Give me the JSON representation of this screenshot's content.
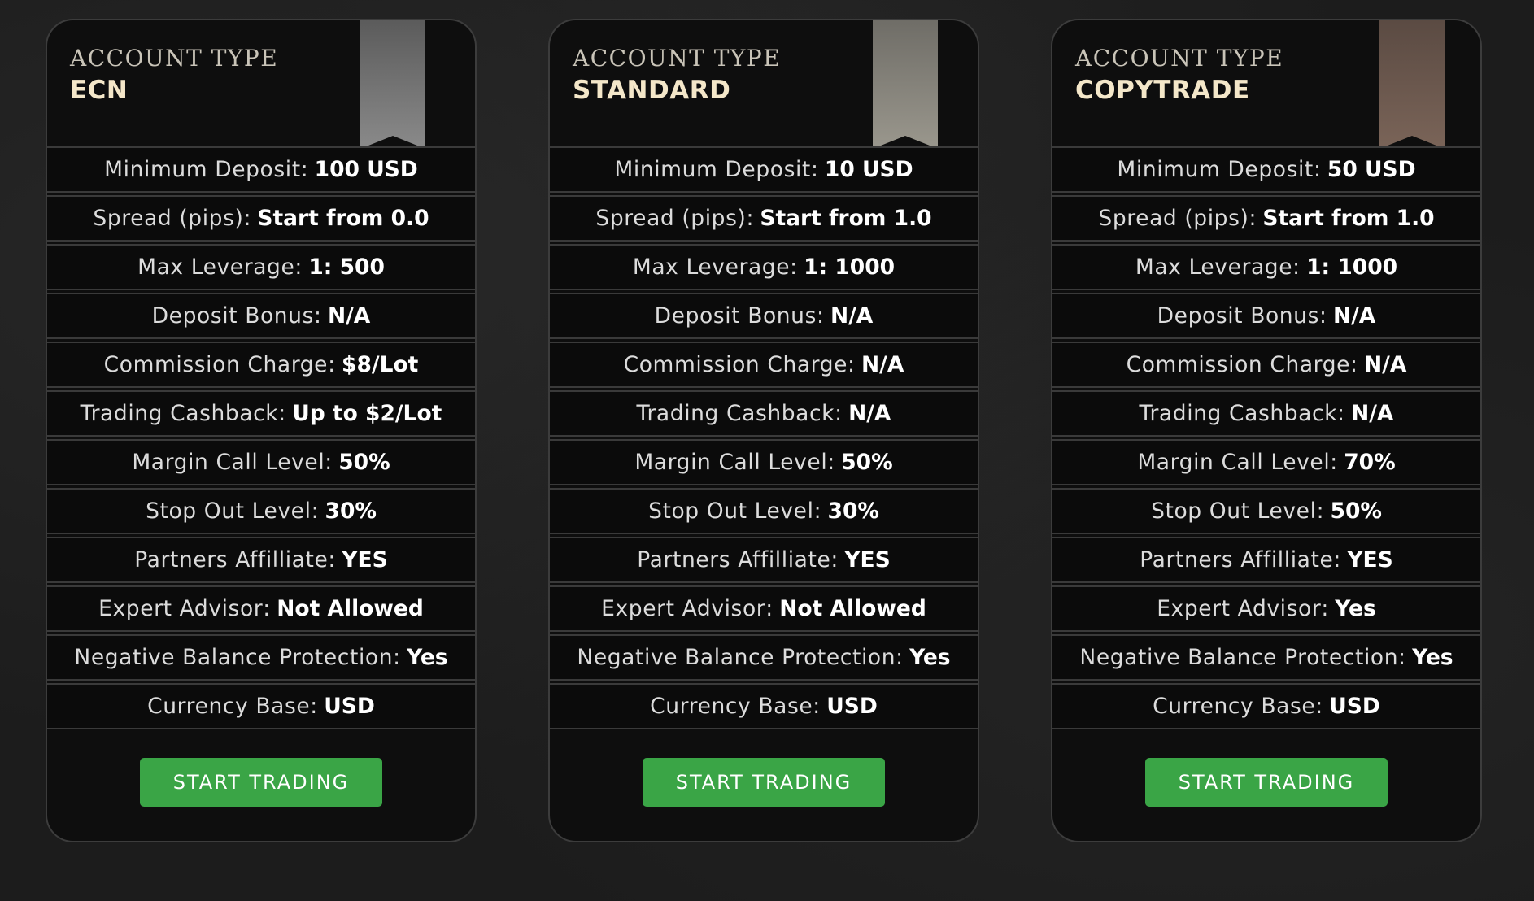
{
  "header_label": "ACCOUNT TYPE",
  "colors": {
    "background": "#1c1c1c",
    "card_background": "#0e0e0e",
    "account_name": "#f4e7c9",
    "button": "#3aa546",
    "ribbon_ecn": "#7a7a7a",
    "ribbon_standard": "#8c8a82",
    "ribbon_copytrade": "#6a5a50"
  },
  "cards": [
    {
      "header_label": "ACCOUNT TYPE",
      "name": "ECN",
      "ribbon_icon": "bookmark-ribbon-icon",
      "features": [
        {
          "label": "Minimum Deposit",
          "value": "100 USD"
        },
        {
          "label": "Spread (pips)",
          "value": "Start from 0.0"
        },
        {
          "label": "Max Leverage",
          "value": "1: 500"
        },
        {
          "label": "Deposit Bonus",
          "value": "N/A"
        },
        {
          "label": "Commission Charge",
          "value": "$8/Lot"
        },
        {
          "label": "Trading Cashback",
          "value": "Up to $2/Lot"
        },
        {
          "label": "Margin Call Level",
          "value": "50%"
        },
        {
          "label": "Stop Out Level",
          "value": "30%"
        },
        {
          "label": "Partners Affilliate",
          "value": "YES"
        },
        {
          "label": "Expert Advisor",
          "value": "Not Allowed"
        },
        {
          "label": "Negative Balance Protection",
          "value": "Yes"
        },
        {
          "label": "Currency Base",
          "value": "USD"
        }
      ],
      "button_label": "START TRADING"
    },
    {
      "header_label": "ACCOUNT TYPE",
      "name": "STANDARD",
      "ribbon_icon": "bookmark-ribbon-icon",
      "features": [
        {
          "label": "Minimum Deposit",
          "value": "10 USD"
        },
        {
          "label": "Spread (pips)",
          "value": "Start from 1.0"
        },
        {
          "label": "Max Leverage",
          "value": "1: 1000"
        },
        {
          "label": "Deposit Bonus",
          "value": "N/A"
        },
        {
          "label": "Commission Charge",
          "value": "N/A"
        },
        {
          "label": "Trading Cashback",
          "value": "N/A"
        },
        {
          "label": "Margin Call Level",
          "value": "50%"
        },
        {
          "label": "Stop Out Level",
          "value": "30%"
        },
        {
          "label": "Partners Affilliate",
          "value": "YES"
        },
        {
          "label": "Expert Advisor",
          "value": "Not Allowed"
        },
        {
          "label": "Negative Balance Protection",
          "value": "Yes"
        },
        {
          "label": "Currency Base",
          "value": "USD"
        }
      ],
      "button_label": "START TRADING"
    },
    {
      "header_label": "ACCOUNT TYPE",
      "name": "COPYTRADE",
      "ribbon_icon": "bookmark-ribbon-icon",
      "features": [
        {
          "label": "Minimum Deposit",
          "value": "50 USD"
        },
        {
          "label": "Spread (pips)",
          "value": "Start from 1.0"
        },
        {
          "label": "Max Leverage",
          "value": "1: 1000"
        },
        {
          "label": "Deposit Bonus",
          "value": "N/A"
        },
        {
          "label": "Commission Charge",
          "value": "N/A"
        },
        {
          "label": "Trading Cashback",
          "value": "N/A"
        },
        {
          "label": "Margin Call Level",
          "value": "70%"
        },
        {
          "label": "Stop Out Level",
          "value": "50%"
        },
        {
          "label": "Partners Affilliate",
          "value": "YES"
        },
        {
          "label": "Expert Advisor",
          "value": "Yes"
        },
        {
          "label": "Negative Balance Protection",
          "value": "Yes"
        },
        {
          "label": "Currency Base",
          "value": "USD"
        }
      ],
      "button_label": "START TRADING"
    }
  ]
}
